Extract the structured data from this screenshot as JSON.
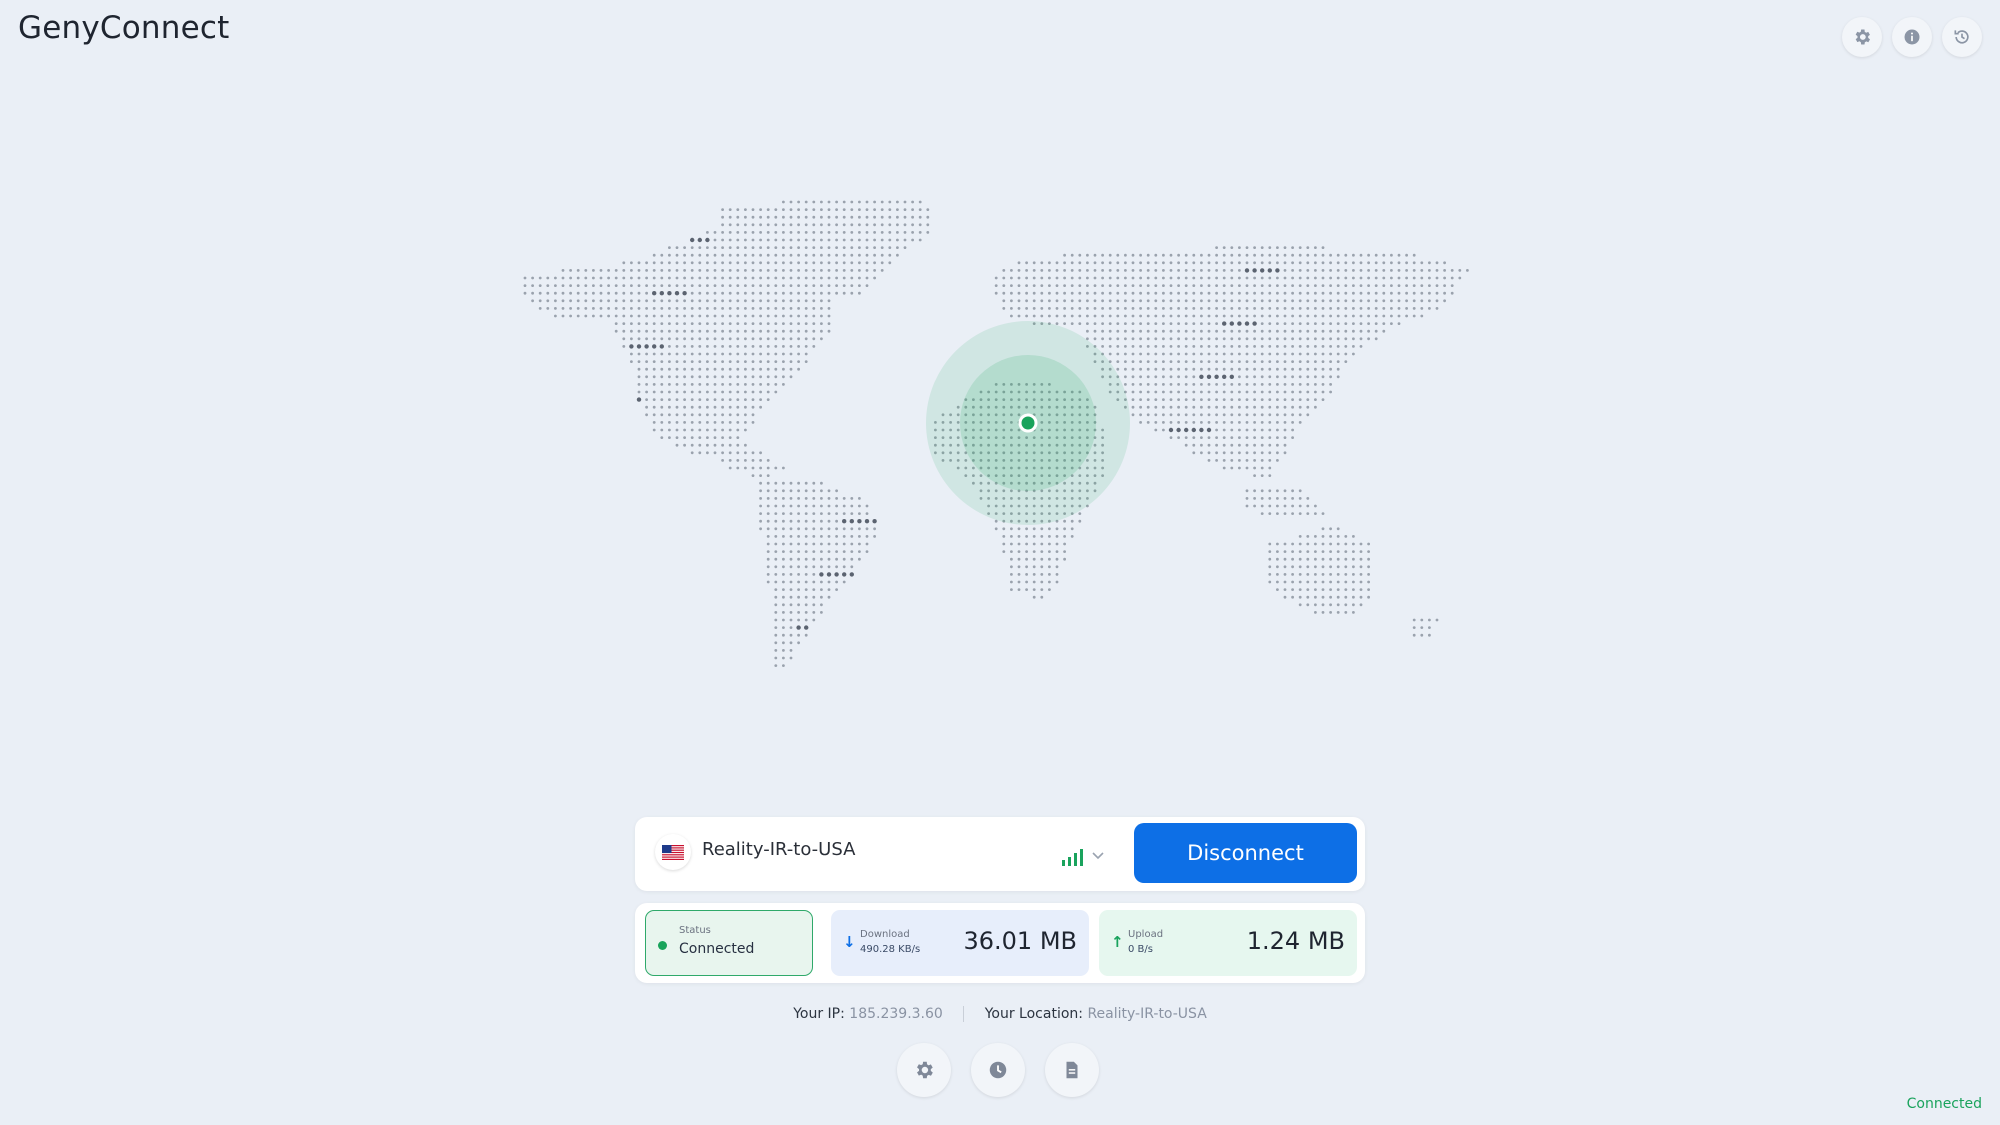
{
  "app": {
    "title": "GenyConnect"
  },
  "header_actions": [
    "gear-icon",
    "info-icon",
    "history-icon"
  ],
  "server": {
    "flag": "🇺🇸",
    "name": "Reality-IR-to-USA",
    "disconnect_label": "Disconnect"
  },
  "stats": {
    "status_label": "Status",
    "status_value": "Connected",
    "download_label": "Download",
    "download_rate": "490.28 KB/s",
    "download_total": "36.01 MB",
    "upload_label": "Upload",
    "upload_rate": "0 B/s",
    "upload_total": "1.24 MB"
  },
  "connection_info": {
    "ip_label": "Your IP:",
    "ip_value": "185.239.3.60",
    "location_label": "Your Location:",
    "location_value": "Reality-IR-to-USA"
  },
  "bottom_actions": [
    "gear-icon",
    "clock-icon",
    "document-icon"
  ],
  "footer": {
    "status": "Connected"
  },
  "colors": {
    "accent": "#0d6fe6",
    "connected": "#19a35b",
    "background": "#eaeff6"
  }
}
